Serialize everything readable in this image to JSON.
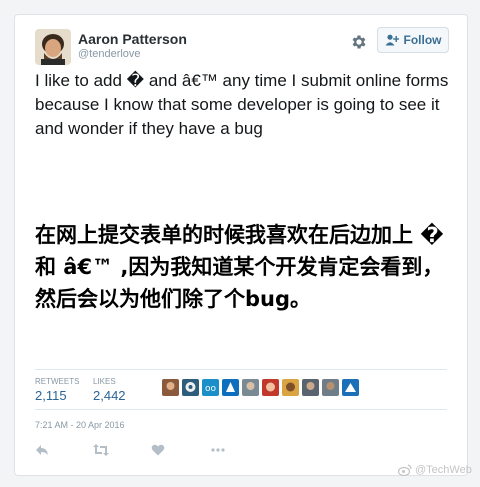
{
  "user": {
    "name": "Aaron Patterson",
    "handle": "@tenderlove"
  },
  "follow_button": {
    "label": "Follow",
    "icon": "add-user-icon"
  },
  "settings_icon": "gear-icon",
  "tweet": {
    "text": "I like to add � and â€™ any time I submit online forms because I know that some developer is going to see it and wonder if they have a bug"
  },
  "overlay": {
    "text": "在网上提交表单的时候我喜欢在后边加上 � 和 â€™ ,因为我知道某个开发肯定会看到，然后会以为他们除了个bug。"
  },
  "stats": {
    "retweets_label": "RETWEETS",
    "retweets_value": "2,115",
    "likes_label": "LIKES",
    "likes_value": "2,442"
  },
  "liker_avatars": 10,
  "timestamp": "7:21 AM - 20 Apr 2016",
  "actions": [
    "reply-icon",
    "retweet-icon",
    "like-icon",
    "more-icon"
  ],
  "watermark": "@TechWeb",
  "colors": {
    "link": "#2a6496",
    "muted": "#8899a6",
    "follow_text": "#3b6f94"
  }
}
